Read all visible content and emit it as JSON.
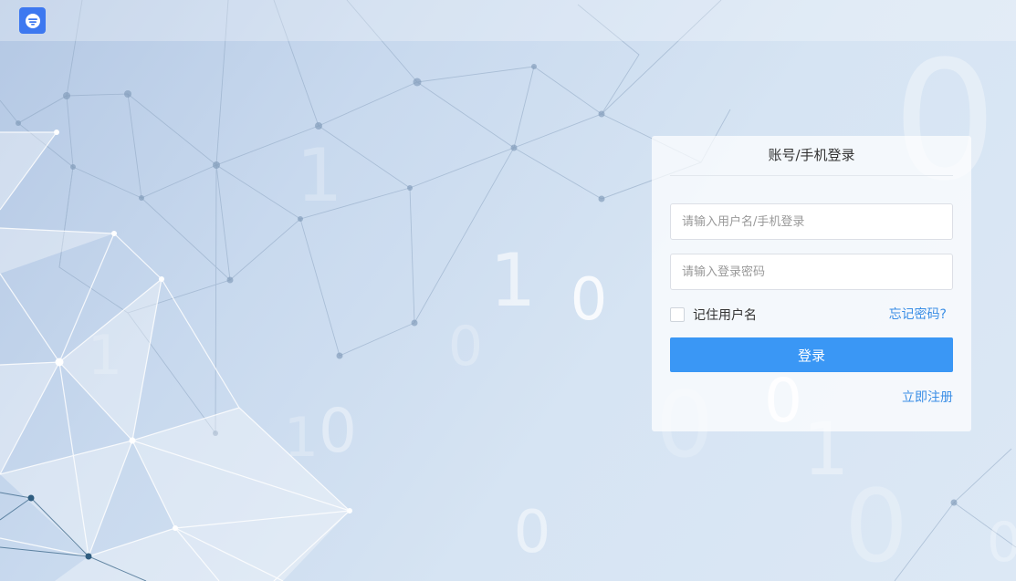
{
  "panel": {
    "title": "账号/手机登录",
    "username_placeholder": "请输入用户名/手机登录",
    "password_placeholder": "请输入登录密码",
    "remember_label": "记住用户名",
    "forgot_link": "忘记密码?",
    "login_button": "登录",
    "register_link": "立即注册"
  },
  "logo": {
    "icon": "app-logo-icon",
    "color": "#3d78f0"
  },
  "decor": {
    "binary_digits": [
      "1",
      "1",
      "0",
      "0",
      "1",
      "1",
      "0",
      "0",
      "0",
      "0",
      "1",
      "0",
      "0",
      "0"
    ]
  },
  "colors": {
    "accent": "#3a97f5",
    "link": "#3a8ee6"
  }
}
